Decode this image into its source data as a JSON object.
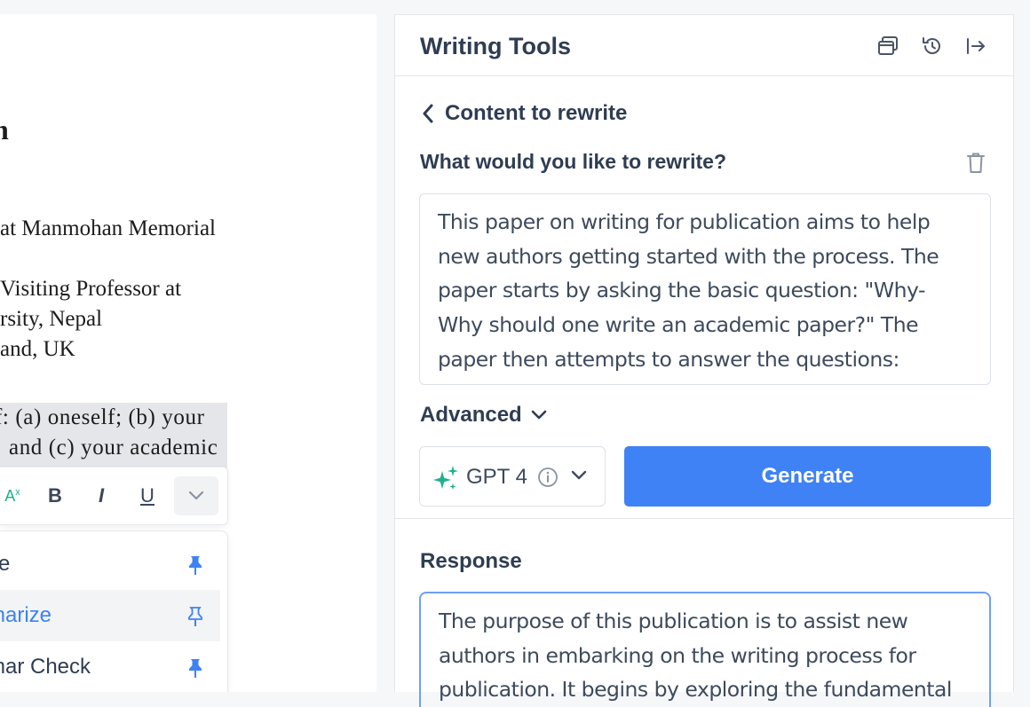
{
  "document": {
    "heading_fragment": "n",
    "lines": [
      "at Manmohan Memorial",
      "Visiting Professor at",
      "rsity, Nepal",
      "and, UK"
    ],
    "highlighted_lines": [
      "f: (a) oneself; (b) your",
      "and (c) your academic"
    ],
    "toolbar": {
      "translate_glyph": "A",
      "translate_sub": "x",
      "bold_label": "B",
      "italic_label": "I",
      "underline_label": "U"
    },
    "menu": {
      "items": [
        {
          "label": "ite",
          "pinned": true
        },
        {
          "label": "marize",
          "pinned": false,
          "active": true
        },
        {
          "label": "mar Check",
          "pinned": true
        }
      ]
    }
  },
  "panel": {
    "title": "Writing Tools",
    "back_label": "Content to rewrite",
    "question": "What would you like to rewrite?",
    "input_text": "This paper on writing for publication aims to help new authors getting started with the process. The paper starts by asking the basic question: \"Why- Why should one write an academic paper?\" The paper then attempts to answer the questions:",
    "advanced_label": "Advanced",
    "model_name": "GPT 4",
    "generate_label": "Generate",
    "response_label": "Response",
    "response_text": "The purpose of this publication is to assist new authors in embarking on the writing process for publication. It begins by exploring the fundamental",
    "icons": [
      "window-icon",
      "history-icon",
      "collapse-panel-icon",
      "chevron-left-icon",
      "trash-icon",
      "chevron-down-icon",
      "sparkles-icon",
      "info-icon"
    ],
    "colors": {
      "accent": "#3f82f5",
      "text": "#2f3d52",
      "sparkle": "#1fb08e",
      "response_border": "#6fa0f5"
    }
  }
}
